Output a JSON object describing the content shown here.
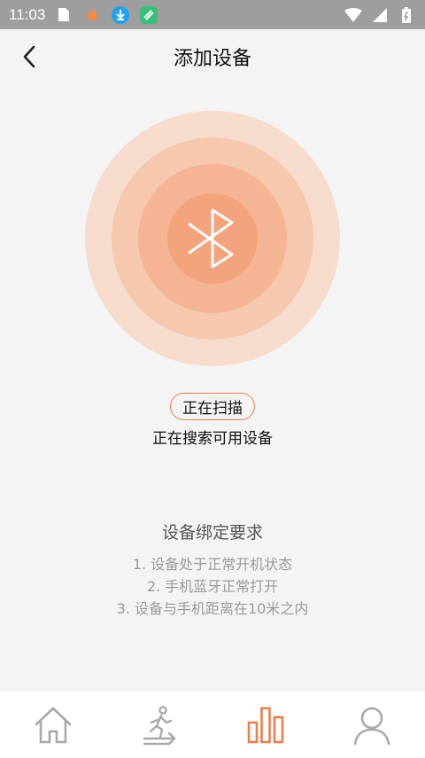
{
  "status_bar": {
    "time": "11:03",
    "icons": [
      "sim-card-icon",
      "fire-icon",
      "download-icon",
      "app-icon",
      "wifi-icon",
      "signal-icon",
      "battery-icon"
    ]
  },
  "header": {
    "title": "添加设备",
    "back_icon": "chevron-left-icon"
  },
  "scanner": {
    "icon": "bluetooth-icon",
    "status_label": "正在扫描",
    "status_text": "正在搜索可用设备"
  },
  "requirements": {
    "title": "设备绑定要求",
    "items": [
      "1. 设备处于正常开机状态",
      "2. 手机蓝牙正常打开",
      "3. 设备与手机距离在10米之内"
    ]
  },
  "tabs": [
    {
      "name": "home",
      "icon": "home-icon",
      "active": false
    },
    {
      "name": "sport",
      "icon": "treadmill-runner-icon",
      "active": false
    },
    {
      "name": "data",
      "icon": "bar-chart-icon",
      "active": true
    },
    {
      "name": "profile",
      "icon": "person-icon",
      "active": false
    }
  ],
  "colors": {
    "accent": "#e8814e",
    "inactive_icon": "#a9a9a9",
    "background": "#f4f4f4"
  }
}
